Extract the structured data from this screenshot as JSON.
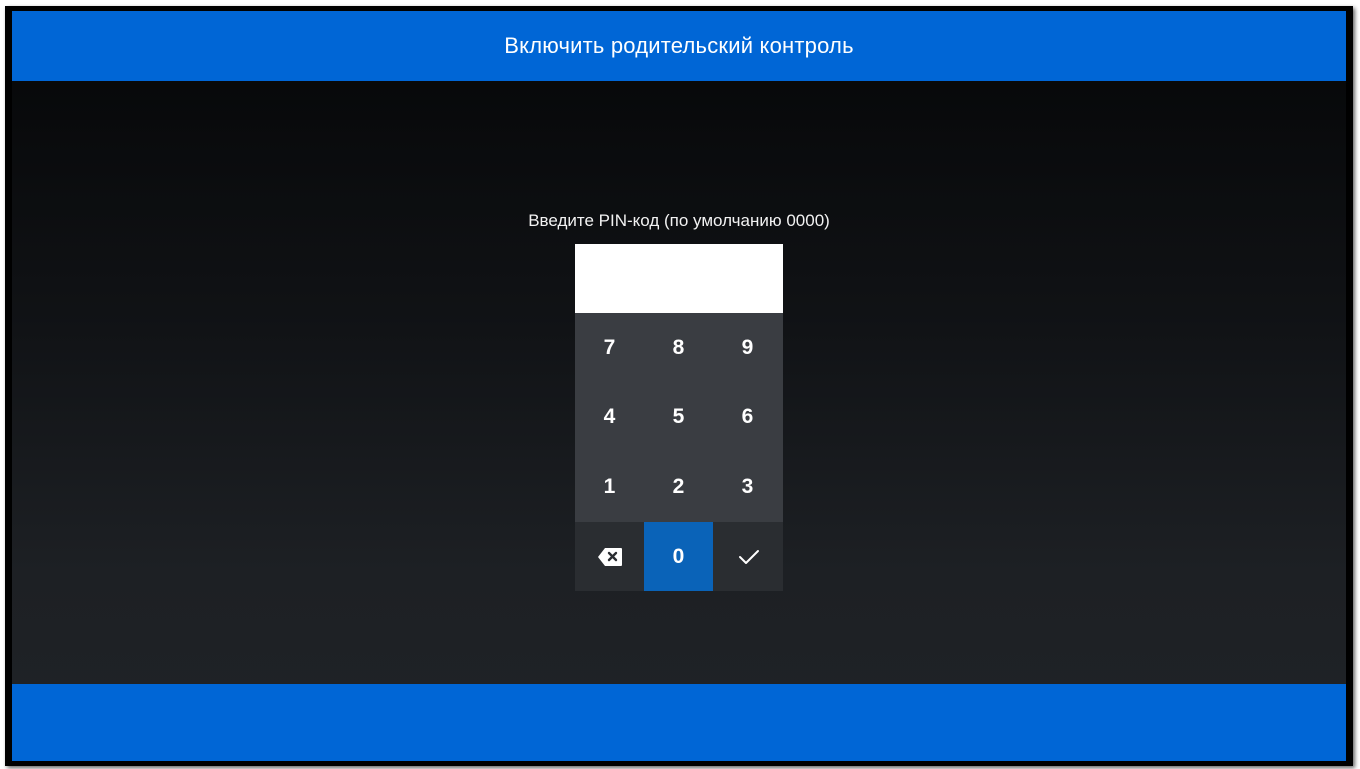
{
  "header": {
    "title": "Включить родительский контроль"
  },
  "prompt": {
    "text": "Введите PIN-код (по умолчанию 0000)"
  },
  "pin_input": {
    "value": ""
  },
  "keypad": {
    "rows": [
      [
        "7",
        "8",
        "9"
      ],
      [
        "4",
        "5",
        "6"
      ],
      [
        "1",
        "2",
        "3"
      ]
    ],
    "bottom": {
      "left_icon": "backspace-icon",
      "center": "0",
      "right_icon": "checkmark-icon"
    },
    "selected_key": "0"
  },
  "colors": {
    "accent": "#0066d6",
    "selected_key": "#0a63b8",
    "keypad_bg": "#3a3d42"
  }
}
